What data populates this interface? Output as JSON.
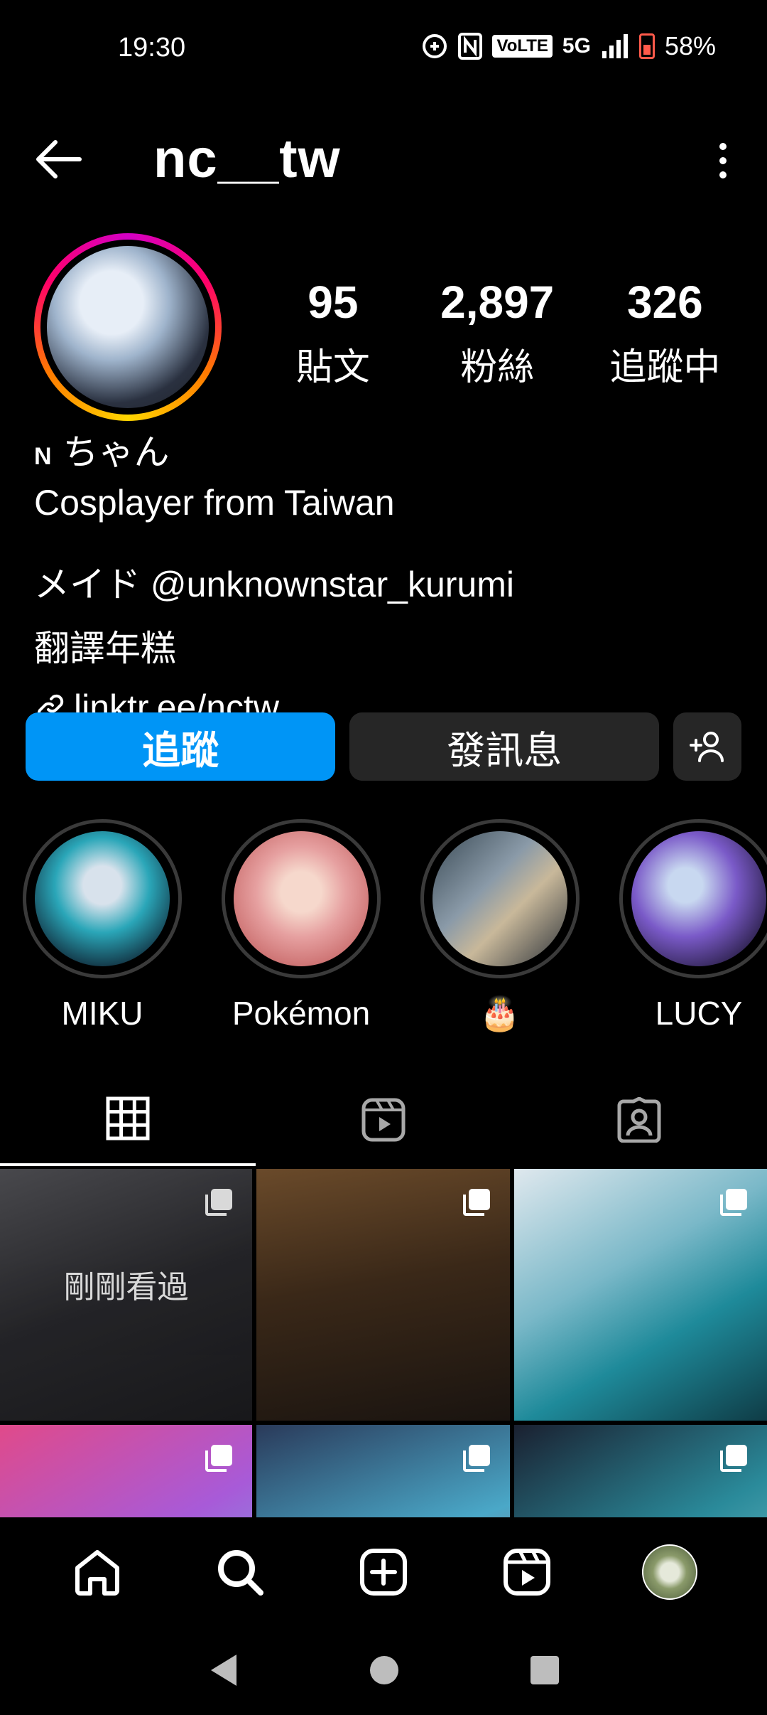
{
  "status_bar": {
    "time": "19:30",
    "volte": "VoLTE",
    "network": "5G",
    "battery": "58%"
  },
  "header": {
    "username": "nc__tw",
    "back_icon": "arrow-left-icon",
    "menu_icon": "more-vertical-icon"
  },
  "profile": {
    "stats": [
      {
        "value": "95",
        "label": "貼文"
      },
      {
        "value": "2,897",
        "label": "粉絲"
      },
      {
        "value": "326",
        "label": "追蹤中"
      }
    ],
    "display_prefix": "N",
    "display_name": "ちゃん",
    "bio_line1": "Cosplayer from Taiwan",
    "bio_line2": "メイド @unknownstar_kurumi",
    "bio_line3": "翻譯年糕",
    "link": "linktr.ee/nctw"
  },
  "buttons": {
    "follow": "追蹤",
    "message": "發訊息"
  },
  "highlights": [
    {
      "label": "MIKU",
      "color": "#2aa6b8"
    },
    {
      "label": "Pokémon",
      "color": "#e6a0a0"
    },
    {
      "label": "🎂",
      "color": "#8a9aa8"
    },
    {
      "label": "LUCY",
      "color": "#7a5ac8"
    }
  ],
  "posts": {
    "recently_viewed": "剛剛看過"
  },
  "colors": {
    "accent": "#0095f6",
    "button_dark": "#262626"
  }
}
